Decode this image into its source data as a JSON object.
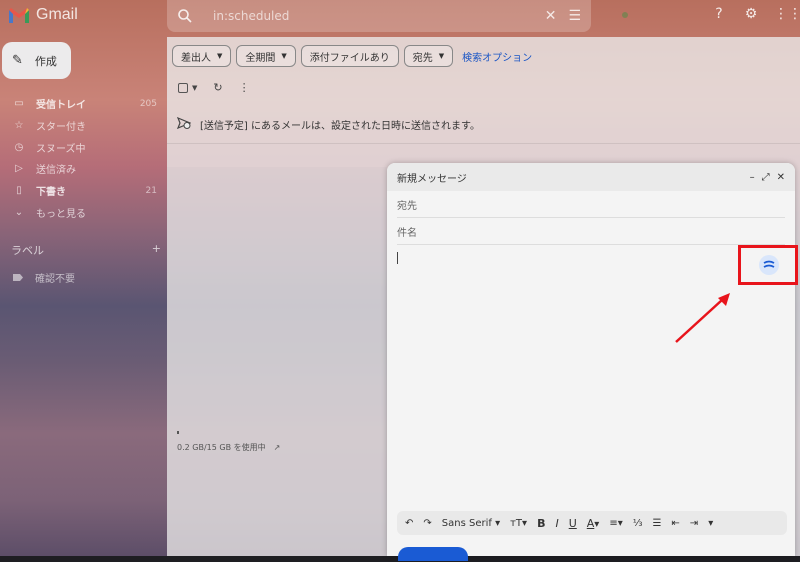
{
  "app": {
    "name": "Gmail"
  },
  "search": {
    "value": "in:scheduled"
  },
  "sidebar": {
    "compose_label": "作成",
    "items": [
      {
        "icon": "inbox-icon",
        "label": "受信トレイ",
        "count": "205"
      },
      {
        "icon": "star-icon",
        "label": "スター付き",
        "count": ""
      },
      {
        "icon": "clock-icon",
        "label": "スヌーズ中",
        "count": ""
      },
      {
        "icon": "send-icon",
        "label": "送信済み",
        "count": ""
      },
      {
        "icon": "draft-icon",
        "label": "下書き",
        "count": "21"
      },
      {
        "icon": "chevron-down-icon",
        "label": "もっと見る",
        "count": ""
      }
    ],
    "labels_title": "ラベル",
    "labels_add": "+",
    "labels": [
      {
        "label": "確認不要"
      }
    ]
  },
  "filters": {
    "chips": [
      "差出人",
      "全期間",
      "添付ファイルあり",
      "宛先"
    ],
    "advanced": "検索オプション"
  },
  "notice": "[送信予定] にあるメールは、設定された日時に送信されます。",
  "storage": "0.2 GB/15 GB を使用中",
  "compose": {
    "title": "新規メッセージ",
    "to_placeholder": "宛先",
    "subject_placeholder": "件名",
    "font": "Sans Serif"
  },
  "colors": {
    "annotation": "#e8141b",
    "send_button": "#1a5bd4",
    "link": "#1a55c5"
  }
}
